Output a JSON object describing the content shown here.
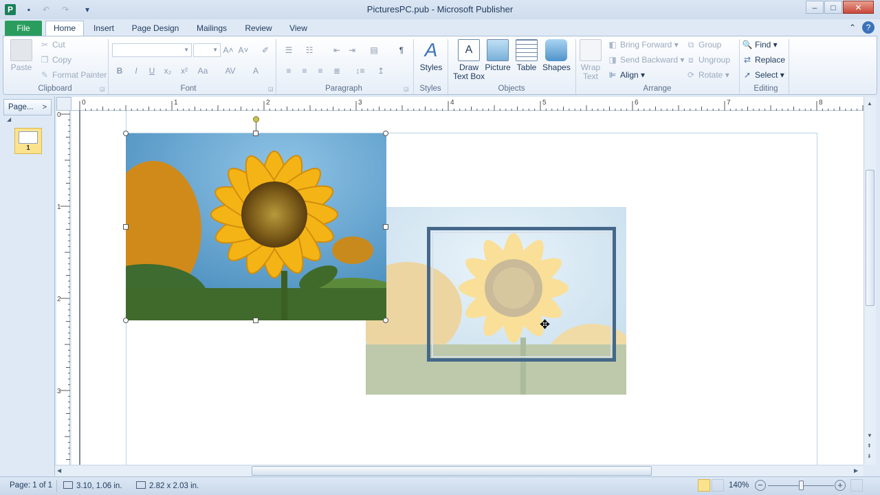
{
  "window": {
    "title": "PicturesPC.pub - Microsoft Publisher",
    "app_icon": "P",
    "buttons": {
      "minimize": "–",
      "maximize": "□",
      "close": "✕"
    }
  },
  "tabs": [
    "File",
    "Home",
    "Insert",
    "Page Design",
    "Mailings",
    "Review",
    "View"
  ],
  "active_tab": "Home",
  "ribbon": {
    "clipboard": {
      "label": "Clipboard",
      "paste": "Paste",
      "cut": "Cut",
      "copy": "Copy",
      "format_painter": "Format Painter"
    },
    "font": {
      "label": "Font",
      "font_name": "",
      "font_size": ""
    },
    "paragraph": {
      "label": "Paragraph",
      "pilcrow": "¶"
    },
    "styles": {
      "label": "Styles",
      "button": "Styles"
    },
    "objects": {
      "label": "Objects",
      "draw_text_box_1": "Draw",
      "draw_text_box_2": "Text Box",
      "picture": "Picture",
      "table": "Table",
      "shapes": "Shapes"
    },
    "arrange": {
      "label": "Arrange",
      "wrap_text_1": "Wrap",
      "wrap_text_2": "Text",
      "bring_forward": "Bring Forward",
      "send_backward": "Send Backward",
      "align": "Align",
      "group": "Group",
      "ungroup": "Ungroup",
      "rotate": "Rotate"
    },
    "editing": {
      "label": "Editing",
      "find": "Find",
      "replace": "Replace",
      "select": "Select"
    }
  },
  "page_pane": {
    "header": "Page...",
    "thumbnail_number": "1"
  },
  "ruler": {
    "horizontal_labels": [
      "0",
      "1",
      "2",
      "3",
      "4",
      "5",
      "6",
      "7",
      "8"
    ],
    "vertical_labels": [
      "0",
      "1",
      "2",
      "3"
    ]
  },
  "status": {
    "page": "Page: 1 of 1",
    "position": "3.10, 1.06 in.",
    "size": "2.82 x 2.03 in.",
    "zoom": "140%"
  },
  "colors": {
    "file_tab": "#2a9d5e",
    "frame_border": "#45688a",
    "selection_handle": "#ffffff",
    "rotation_handle": "#c9c24e"
  }
}
